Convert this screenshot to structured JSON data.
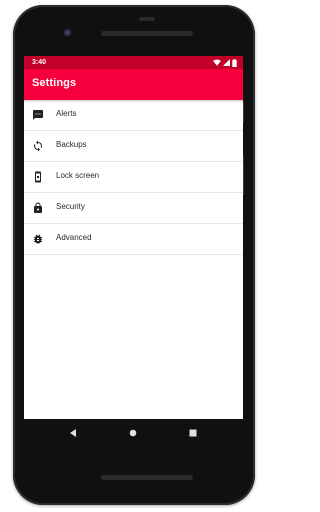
{
  "status_bar": {
    "time": "3:40",
    "icons": [
      "wifi-icon",
      "cell-signal-icon",
      "battery-icon"
    ]
  },
  "app_bar": {
    "title": "Settings",
    "color": "#f5003d",
    "status_color": "#c2002a"
  },
  "settings": {
    "items": [
      {
        "label": "Alerts",
        "icon": "message-icon"
      },
      {
        "label": "Backups",
        "icon": "sync-icon"
      },
      {
        "label": "Lock screen",
        "icon": "phone-lock-icon"
      },
      {
        "label": "Security",
        "icon": "padlock-icon"
      },
      {
        "label": "Advanced",
        "icon": "bug-icon"
      }
    ]
  },
  "nav_bar": {
    "buttons": [
      "back-icon",
      "home-icon",
      "recents-icon"
    ]
  }
}
